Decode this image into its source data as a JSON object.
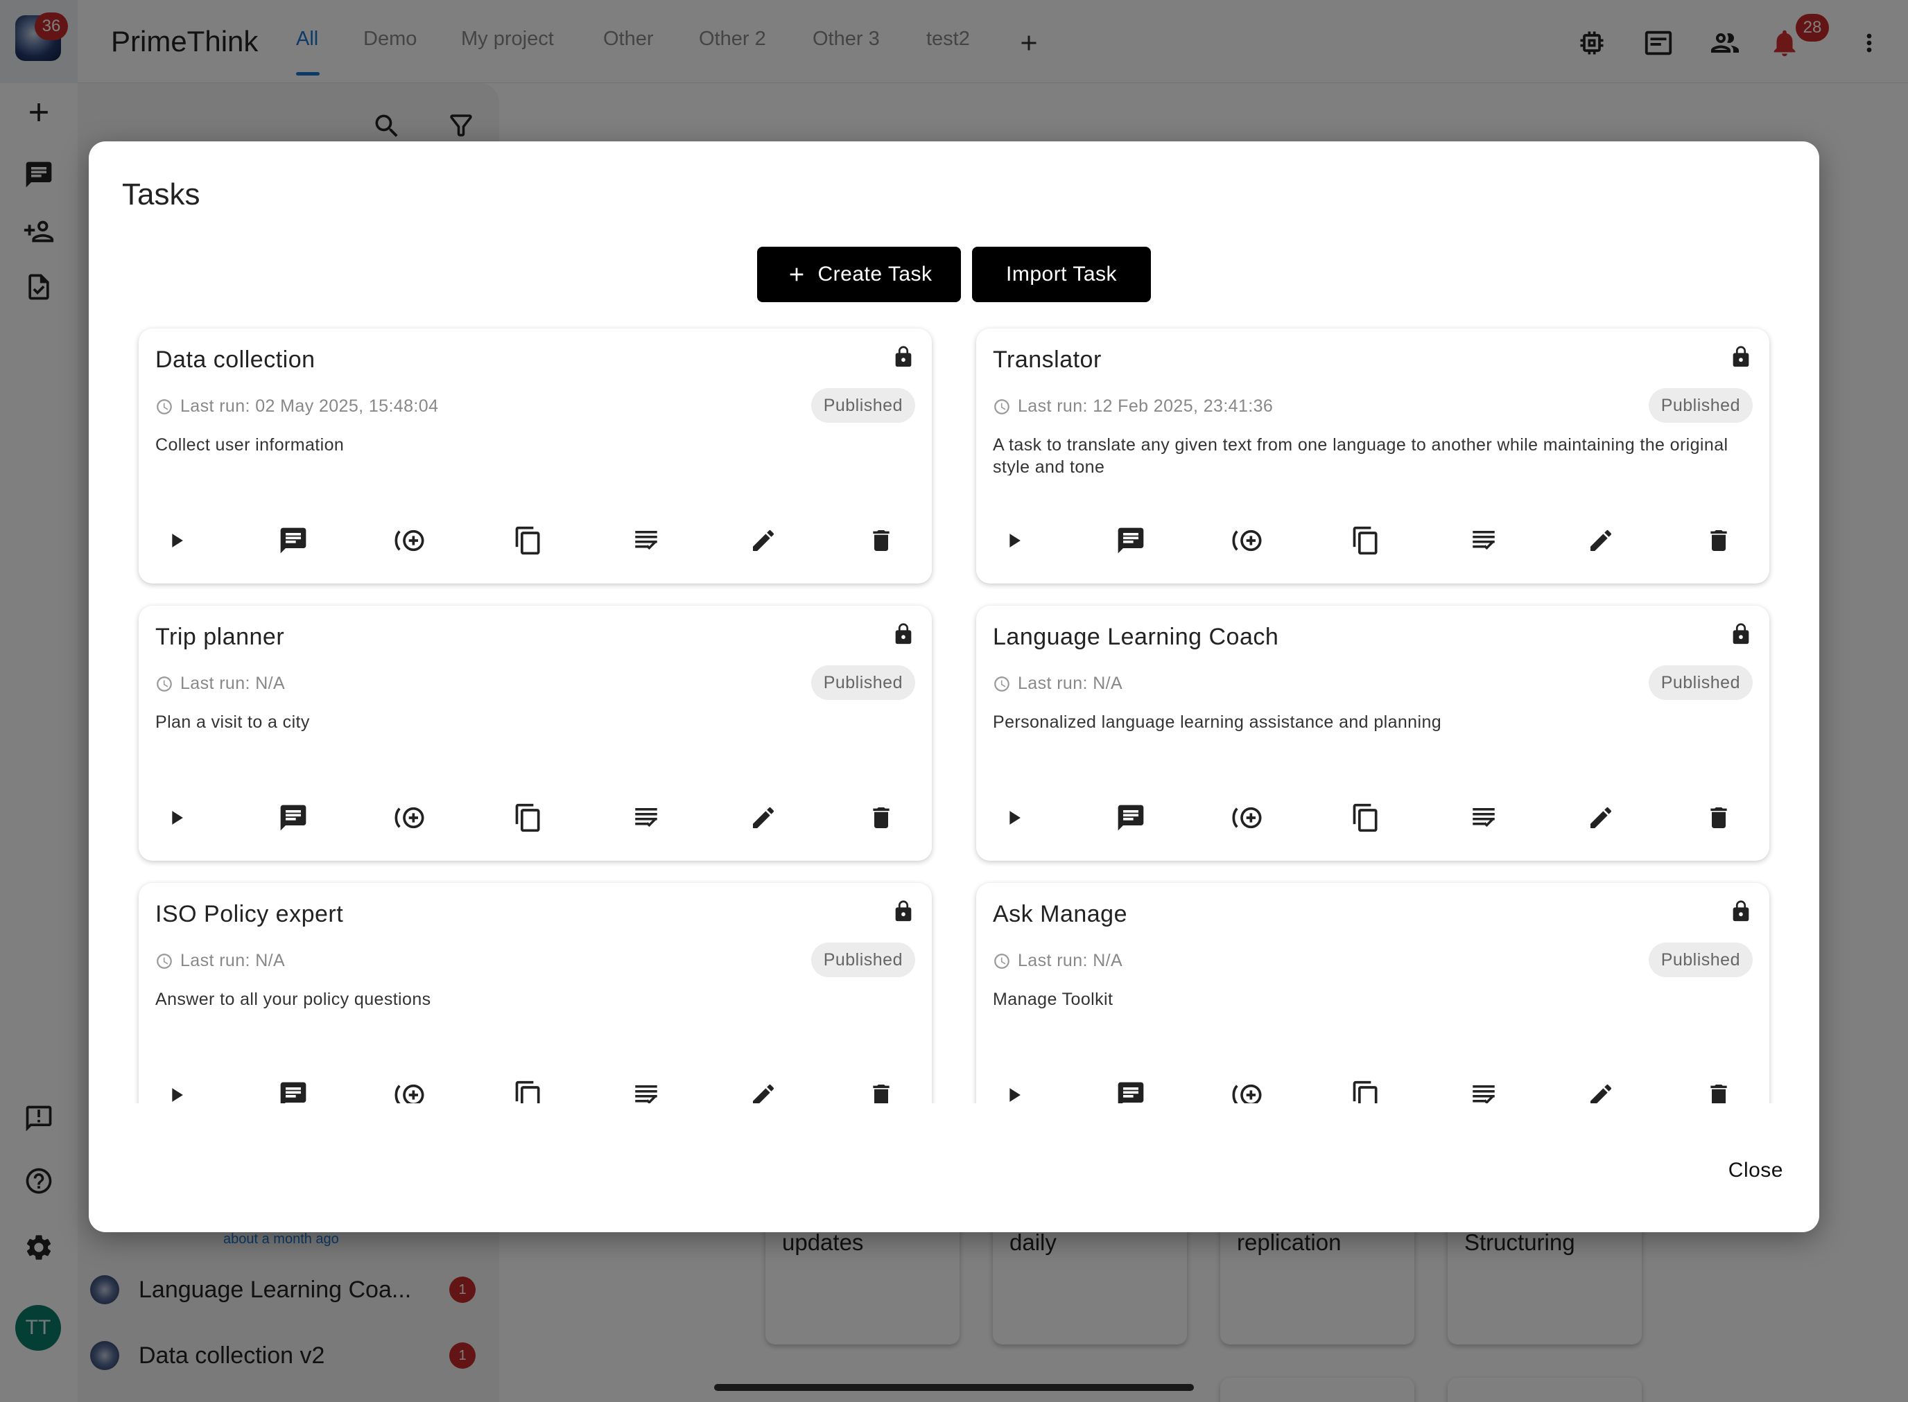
{
  "app": {
    "brand": "PrimeThink",
    "logo_badge": "36",
    "notification_badge": "28",
    "tabs": [
      {
        "label": "All",
        "active": true
      },
      {
        "label": "Demo"
      },
      {
        "label": "My project"
      },
      {
        "label": "Other"
      },
      {
        "label": "Other 2"
      },
      {
        "label": "Other 3"
      },
      {
        "label": "test2"
      }
    ],
    "avatar_initials": "TT"
  },
  "sidebar": {
    "time_label": "about a month ago",
    "chats": [
      {
        "label": "Language Learning Coa...",
        "count": "1"
      },
      {
        "label": "Data collection v2",
        "count": "1"
      }
    ]
  },
  "background_cards": [
    {
      "title": "updates"
    },
    {
      "title": "daily"
    },
    {
      "title": "replication"
    },
    {
      "title": "Structuring"
    }
  ],
  "dialog": {
    "title": "Tasks",
    "create_label": "Create Task",
    "import_label": "Import Task",
    "close_label": "Close",
    "tasks": [
      {
        "title": "Data collection",
        "last_run": "Last run: 02 May 2025, 15:48:04",
        "status": "Published",
        "description": "Collect user information"
      },
      {
        "title": "Translator",
        "last_run": "Last run: 12 Feb 2025, 23:41:36",
        "status": "Published",
        "description": "A task to translate any given text from one language to another while maintaining the original style and tone"
      },
      {
        "title": "Trip planner",
        "last_run": "Last run: N/A",
        "status": "Published",
        "description": "Plan a visit to a city"
      },
      {
        "title": "Language Learning Coach",
        "last_run": "Last run: N/A",
        "status": "Published",
        "description": "Personalized language learning assistance and planning"
      },
      {
        "title": "ISO Policy expert",
        "last_run": "Last run: N/A",
        "status": "Published",
        "description": "Answer to all your policy questions"
      },
      {
        "title": "Ask Manage",
        "last_run": "Last run: N/A",
        "status": "Published",
        "description": "Manage Toolkit"
      }
    ]
  },
  "colors": {
    "accent": "#1976d2",
    "badge": "#c62828",
    "avatar": "#0a7d6b"
  }
}
